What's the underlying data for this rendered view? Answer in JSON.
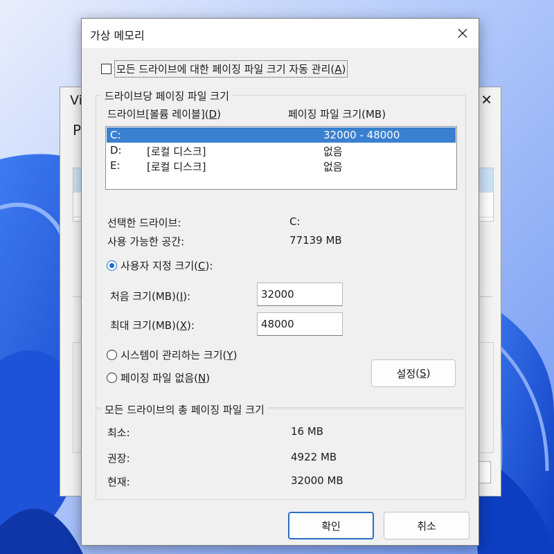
{
  "background_window": {
    "title": "Vi",
    "heading": "P",
    "close_glyph": "✕"
  },
  "dialog": {
    "title": "가상 메모리",
    "close_glyph": "✕",
    "auto_manage": {
      "label": "모든 드라이브에 대한 페이징 파일 크기 자동 관리",
      "accesskey": "A",
      "checked": false
    },
    "per_drive": {
      "legend": "드라이브당 페이징 파일 크기",
      "col_drive": "드라이브[볼륨 레이블]",
      "col_drive_key": "D",
      "col_size": "페이징 파일 크기(MB)",
      "drives": [
        {
          "letter": "C:",
          "label": "",
          "size": "32000 - 48000",
          "selected": true
        },
        {
          "letter": "D:",
          "label": "[로컬 디스크]",
          "size": "없음",
          "selected": false
        },
        {
          "letter": "E:",
          "label": "[로컬 디스크]",
          "size": "없음",
          "selected": false
        }
      ],
      "selected_drive_label": "선택한 드라이브:",
      "selected_drive_value": "C:",
      "space_available_label": "사용 가능한 공간:",
      "space_available_value": "77139 MB",
      "custom_size": {
        "label": "사용자 지정 크기",
        "key": "C",
        "selected": true
      },
      "initial_size": {
        "label": "처음 크기(MB)",
        "key": "I",
        "value": "32000"
      },
      "max_size": {
        "label": "최대 크기(MB)",
        "key": "X",
        "value": "48000"
      },
      "system_managed": {
        "label": "시스템이 관리하는 크기",
        "key": "Y",
        "selected": false
      },
      "no_paging": {
        "label": "페이징 파일 없음",
        "key": "N",
        "selected": false
      },
      "set_button": {
        "label": "설정",
        "key": "S"
      }
    },
    "total": {
      "legend": "모든 드라이브의 총 페이징 파일 크기",
      "minimum_label": "최소:",
      "minimum_value": "16 MB",
      "recommended_label": "권장:",
      "recommended_value": "4922 MB",
      "current_label": "현재:",
      "current_value": "32000 MB"
    },
    "ok_label": "확인",
    "cancel_label": "취소"
  },
  "colors": {
    "wallpaper": "#2f6ae0",
    "selection": "#3a80d0",
    "accent": "#1a6ad0"
  }
}
